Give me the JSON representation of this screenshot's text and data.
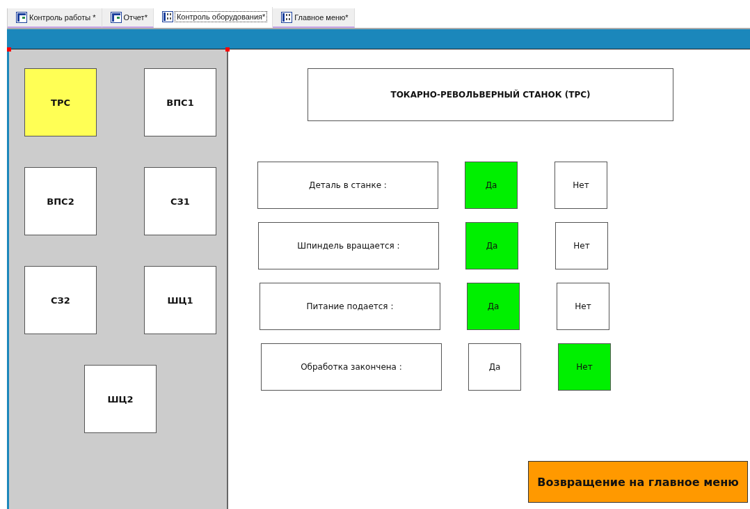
{
  "tabs": [
    {
      "label": "Контроль работы *",
      "kind": "form",
      "selected": false
    },
    {
      "label": "Отчет*",
      "kind": "form",
      "selected": false
    },
    {
      "label": "Контроль оборудования*",
      "kind": "grid",
      "selected": true
    },
    {
      "label": "Главное меню*",
      "kind": "grid",
      "selected": false
    }
  ],
  "equipment": [
    {
      "label": "ТРС",
      "selected": true
    },
    {
      "label": "ВПС1",
      "selected": false
    },
    {
      "label": "ВПС2",
      "selected": false
    },
    {
      "label": "СЗ1",
      "selected": false
    },
    {
      "label": "СЗ2",
      "selected": false
    },
    {
      "label": "ШЦ1",
      "selected": false
    },
    {
      "label": "ШЦ2",
      "selected": false
    }
  ],
  "title": "ТОКАРНО-РЕВОЛЬВЕРНЫЙ СТАНОК (ТРС)",
  "status_rows": [
    {
      "label": "Деталь в станке :",
      "options": [
        {
          "label": "Да",
          "on": true
        },
        {
          "label": "Нет",
          "on": false
        }
      ]
    },
    {
      "label": "Шпиндель вращается :",
      "options": [
        {
          "label": "Да",
          "on": true
        },
        {
          "label": "Нет",
          "on": false
        }
      ]
    },
    {
      "label": "Питание подается :",
      "options": [
        {
          "label": "Да",
          "on": true
        },
        {
          "label": "Нет",
          "on": false
        }
      ]
    },
    {
      "label": "Обработка закончена :",
      "options": [
        {
          "label": "Да",
          "on": false
        },
        {
          "label": "Нет",
          "on": true
        }
      ]
    }
  ],
  "return_button": "Возвращение на главное меню"
}
